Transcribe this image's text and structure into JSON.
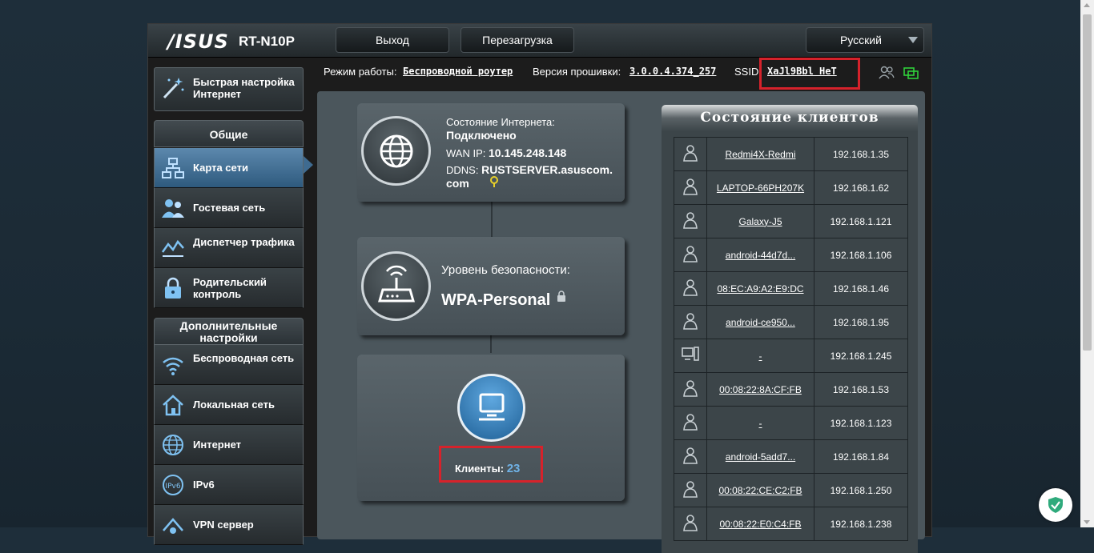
{
  "header": {
    "logo": "/ISUS",
    "model": "RT-N10P",
    "logout_label": "Выход",
    "reboot_label": "Перезагрузка",
    "language_selected": "Русский"
  },
  "info": {
    "mode_label": "Режим работы:",
    "mode_value": "Беспроводной роутер",
    "firmware_label": "Версия прошивки:",
    "firmware_value": "3.0.0.4.374_257",
    "ssid_label": "SSID",
    "ssid_value": "XaJl9Bbl HeT"
  },
  "sidebar": {
    "quick_setup": "Быстрая настройка Интернет",
    "general_header": "Общие",
    "general_items": [
      {
        "label": "Карта сети"
      },
      {
        "label": "Гостевая сеть"
      },
      {
        "label": "Диспетчер трафика"
      },
      {
        "label": "Родительский контроль"
      }
    ],
    "advanced_header": "Дополнительные настройки",
    "advanced_items": [
      {
        "label": "Беспроводная сеть"
      },
      {
        "label": "Локальная сеть"
      },
      {
        "label": "Интернет"
      },
      {
        "label": "IPv6"
      },
      {
        "label": "VPN сервер"
      }
    ]
  },
  "map": {
    "internet": {
      "status_label": "Состояние Интернета:",
      "status_value": "Подключено",
      "wan_label": "WAN IP:",
      "wan_value": "10.145.248.148",
      "ddns_label": "DDNS:",
      "ddns_value": "RUSTSERVER.asuscom.com"
    },
    "security": {
      "label": "Уровень безопасности:",
      "value": "WPA-Personal"
    },
    "clients": {
      "label": "Клиенты:",
      "count": "23"
    }
  },
  "clients_panel": {
    "title": "Состояние клиентов",
    "rows": [
      {
        "icon": "person-icon",
        "name": "Redmi4X-Redmi",
        "ip": "192.168.1.35"
      },
      {
        "icon": "person-icon",
        "name": "LAPTOP-66PH207K",
        "ip": "192.168.1.62"
      },
      {
        "icon": "person-icon",
        "name": "Galaxy-J5",
        "ip": "192.168.1.121"
      },
      {
        "icon": "person-icon",
        "name": "android-44d7d...",
        "ip": "192.168.1.106"
      },
      {
        "icon": "person-icon",
        "name": "08:EC:A9:A2:E9:DC",
        "ip": "192.168.1.46"
      },
      {
        "icon": "person-icon",
        "name": "android-ce950...",
        "ip": "192.168.1.95"
      },
      {
        "icon": "computer-icon",
        "name": "-",
        "ip": "192.168.1.245"
      },
      {
        "icon": "person-icon",
        "name": "00:08:22:8A:CF:FB",
        "ip": "192.168.1.53"
      },
      {
        "icon": "person-icon",
        "name": "-",
        "ip": "192.168.1.123"
      },
      {
        "icon": "person-icon",
        "name": "android-5add7...",
        "ip": "192.168.1.84"
      },
      {
        "icon": "person-icon",
        "name": "00:08:22:CE:C2:FB",
        "ip": "192.168.1.250"
      },
      {
        "icon": "person-icon",
        "name": "00:08:22:E0:C4:FB",
        "ip": "192.168.1.238"
      }
    ]
  },
  "colors": {
    "highlight_red": "#d6222b",
    "active_blue": "#3f6b90",
    "clients_count": "#6fb2e6"
  }
}
